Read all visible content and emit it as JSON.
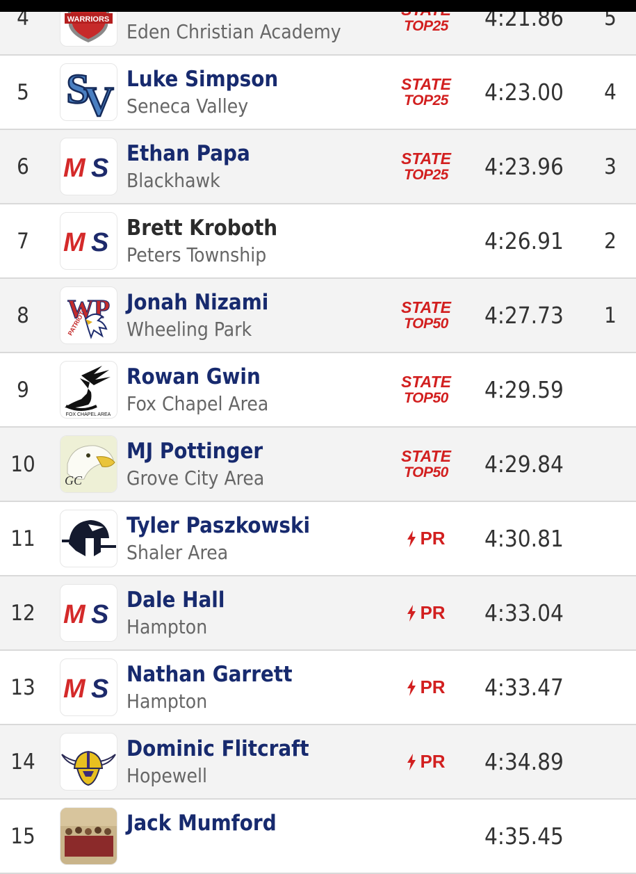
{
  "results": [
    {
      "place": "4",
      "name": "",
      "school": "Eden Christian Academy",
      "time": "4:21.86",
      "points": "5",
      "badge": {
        "kind": "state",
        "line1": "STATE",
        "line2": "TOP25"
      },
      "logo": "warriors-shield-logo",
      "logo_text": "WARRIORS"
    },
    {
      "place": "5",
      "name": "Luke Simpson",
      "school": "Seneca Valley",
      "time": "4:23.00",
      "points": "4",
      "badge": {
        "kind": "state",
        "line1": "STATE",
        "line2": "TOP25"
      },
      "logo": "sv-letters-logo",
      "logo_text": "SV"
    },
    {
      "place": "6",
      "name": "Ethan Papa",
      "school": "Blackhawk",
      "time": "4:23.96",
      "points": "3",
      "badge": {
        "kind": "state",
        "line1": "STATE",
        "line2": "TOP25"
      },
      "logo": "ms-placeholder-logo",
      "logo_text": "MS"
    },
    {
      "place": "7",
      "name": "Brett Kroboth",
      "school": "Peters Township",
      "time": "4:26.91",
      "points": "2",
      "badge": {
        "kind": "none"
      },
      "logo": "ms-placeholder-logo",
      "logo_text": "MS"
    },
    {
      "place": "8",
      "name": "Jonah Nizami",
      "school": "Wheeling Park",
      "time": "4:27.73",
      "points": "1",
      "badge": {
        "kind": "state",
        "line1": "STATE",
        "line2": "TOP50"
      },
      "logo": "patriots-eagle-logo",
      "logo_text": "WP"
    },
    {
      "place": "9",
      "name": "Rowan Gwin",
      "school": "Fox Chapel Area",
      "time": "4:29.59",
      "points": "",
      "badge": {
        "kind": "state",
        "line1": "STATE",
        "line2": "TOP50"
      },
      "logo": "winged-foot-logo",
      "logo_text": "FOX CHAPEL AREA"
    },
    {
      "place": "10",
      "name": "MJ Pottinger",
      "school": "Grove City Area",
      "time": "4:29.84",
      "points": "",
      "badge": {
        "kind": "state",
        "line1": "STATE",
        "line2": "TOP50"
      },
      "logo": "eagle-head-logo",
      "logo_text": "GC"
    },
    {
      "place": "11",
      "name": "Tyler Paszkowski",
      "school": "Shaler Area",
      "time": "4:30.81",
      "points": "",
      "badge": {
        "kind": "pr",
        "label": "PR"
      },
      "logo": "titan-helmet-logo",
      "logo_text": ""
    },
    {
      "place": "12",
      "name": "Dale Hall",
      "school": "Hampton",
      "time": "4:33.04",
      "points": "",
      "badge": {
        "kind": "pr",
        "label": "PR"
      },
      "logo": "ms-placeholder-logo",
      "logo_text": "MS"
    },
    {
      "place": "13",
      "name": "Nathan Garrett",
      "school": "Hampton",
      "time": "4:33.47",
      "points": "",
      "badge": {
        "kind": "pr",
        "label": "PR"
      },
      "logo": "ms-placeholder-logo",
      "logo_text": "MS"
    },
    {
      "place": "14",
      "name": "Dominic Flitcraft",
      "school": "Hopewell",
      "time": "4:34.89",
      "points": "",
      "badge": {
        "kind": "pr",
        "label": "PR"
      },
      "logo": "viking-helmet-logo",
      "logo_text": ""
    },
    {
      "place": "15",
      "name": "Jack Mumford",
      "school": "",
      "time": "4:35.45",
      "points": "",
      "badge": {
        "kind": "none"
      },
      "logo": "team-photo-logo",
      "logo_text": ""
    }
  ],
  "colors": {
    "athlete_name": "#172a6e",
    "unlinked_name": "#2b2b2b",
    "badge_red": "#d21f1f",
    "ms_red": "#d42a2a",
    "ms_navy": "#1d2a6b",
    "row_alt_bg": "#f3f3f3"
  }
}
